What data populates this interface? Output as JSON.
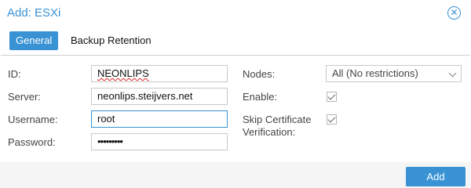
{
  "dialog": {
    "title": "Add: ESXi",
    "close_icon": "close-icon"
  },
  "tabs": [
    {
      "label": "General",
      "active": true
    },
    {
      "label": "Backup Retention",
      "active": false
    }
  ],
  "form": {
    "id": {
      "label": "ID:",
      "value": "NEONLIPS"
    },
    "server": {
      "label": "Server:",
      "value": "neonlips.steijvers.net"
    },
    "username": {
      "label": "Username:",
      "value": "root"
    },
    "password": {
      "label": "Password:",
      "value": "•••••••••"
    },
    "nodes": {
      "label": "Nodes:",
      "value": "All (No restrictions)"
    },
    "enable": {
      "label": "Enable:",
      "checked": true
    },
    "skip_cert": {
      "label_line1": "Skip Certificate",
      "label_line2": "Verification:",
      "checked": true
    }
  },
  "footer": {
    "add_label": "Add"
  },
  "colors": {
    "accent": "#3892d4",
    "footer_bg": "#f5f5f5",
    "border": "#c9c9c9"
  }
}
